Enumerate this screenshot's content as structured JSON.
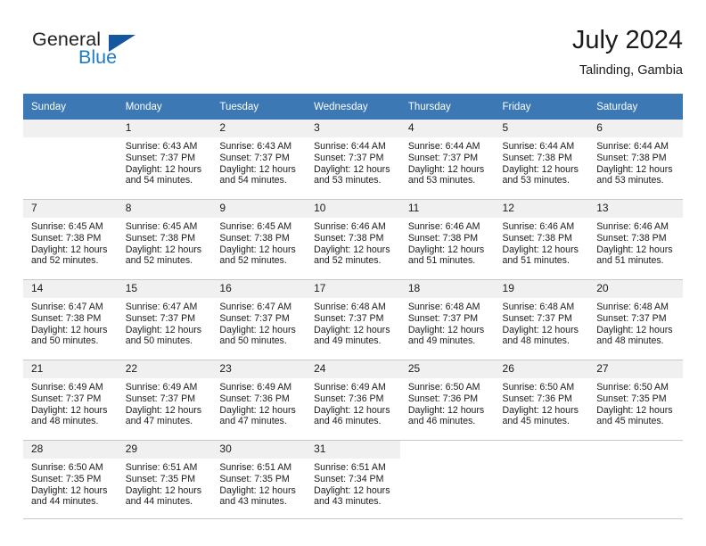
{
  "brand": {
    "word1": "General",
    "word2": "Blue",
    "triangle_color": "#15579e",
    "blue_color": "#1e7bc4"
  },
  "header": {
    "title": "July 2024",
    "subtitle": "Talinding, Gambia"
  },
  "theme": {
    "header_row_bg": "#3b78b4",
    "daynum_bg": "#f0f0f0",
    "grid_line": "#c8c8c8"
  },
  "weekdays": [
    "Sunday",
    "Monday",
    "Tuesday",
    "Wednesday",
    "Thursday",
    "Friday",
    "Saturday"
  ],
  "weeks": [
    [
      {
        "day": "",
        "blank": true,
        "sunrise": "",
        "sunset": "",
        "daylight1": "",
        "daylight2": ""
      },
      {
        "day": "1",
        "sunrise": "Sunrise: 6:43 AM",
        "sunset": "Sunset: 7:37 PM",
        "daylight1": "Daylight: 12 hours",
        "daylight2": "and 54 minutes."
      },
      {
        "day": "2",
        "sunrise": "Sunrise: 6:43 AM",
        "sunset": "Sunset: 7:37 PM",
        "daylight1": "Daylight: 12 hours",
        "daylight2": "and 54 minutes."
      },
      {
        "day": "3",
        "sunrise": "Sunrise: 6:44 AM",
        "sunset": "Sunset: 7:37 PM",
        "daylight1": "Daylight: 12 hours",
        "daylight2": "and 53 minutes."
      },
      {
        "day": "4",
        "sunrise": "Sunrise: 6:44 AM",
        "sunset": "Sunset: 7:37 PM",
        "daylight1": "Daylight: 12 hours",
        "daylight2": "and 53 minutes."
      },
      {
        "day": "5",
        "sunrise": "Sunrise: 6:44 AM",
        "sunset": "Sunset: 7:38 PM",
        "daylight1": "Daylight: 12 hours",
        "daylight2": "and 53 minutes."
      },
      {
        "day": "6",
        "sunrise": "Sunrise: 6:44 AM",
        "sunset": "Sunset: 7:38 PM",
        "daylight1": "Daylight: 12 hours",
        "daylight2": "and 53 minutes."
      }
    ],
    [
      {
        "day": "7",
        "sunrise": "Sunrise: 6:45 AM",
        "sunset": "Sunset: 7:38 PM",
        "daylight1": "Daylight: 12 hours",
        "daylight2": "and 52 minutes."
      },
      {
        "day": "8",
        "sunrise": "Sunrise: 6:45 AM",
        "sunset": "Sunset: 7:38 PM",
        "daylight1": "Daylight: 12 hours",
        "daylight2": "and 52 minutes."
      },
      {
        "day": "9",
        "sunrise": "Sunrise: 6:45 AM",
        "sunset": "Sunset: 7:38 PM",
        "daylight1": "Daylight: 12 hours",
        "daylight2": "and 52 minutes."
      },
      {
        "day": "10",
        "sunrise": "Sunrise: 6:46 AM",
        "sunset": "Sunset: 7:38 PM",
        "daylight1": "Daylight: 12 hours",
        "daylight2": "and 52 minutes."
      },
      {
        "day": "11",
        "sunrise": "Sunrise: 6:46 AM",
        "sunset": "Sunset: 7:38 PM",
        "daylight1": "Daylight: 12 hours",
        "daylight2": "and 51 minutes."
      },
      {
        "day": "12",
        "sunrise": "Sunrise: 6:46 AM",
        "sunset": "Sunset: 7:38 PM",
        "daylight1": "Daylight: 12 hours",
        "daylight2": "and 51 minutes."
      },
      {
        "day": "13",
        "sunrise": "Sunrise: 6:46 AM",
        "sunset": "Sunset: 7:38 PM",
        "daylight1": "Daylight: 12 hours",
        "daylight2": "and 51 minutes."
      }
    ],
    [
      {
        "day": "14",
        "sunrise": "Sunrise: 6:47 AM",
        "sunset": "Sunset: 7:38 PM",
        "daylight1": "Daylight: 12 hours",
        "daylight2": "and 50 minutes."
      },
      {
        "day": "15",
        "sunrise": "Sunrise: 6:47 AM",
        "sunset": "Sunset: 7:37 PM",
        "daylight1": "Daylight: 12 hours",
        "daylight2": "and 50 minutes."
      },
      {
        "day": "16",
        "sunrise": "Sunrise: 6:47 AM",
        "sunset": "Sunset: 7:37 PM",
        "daylight1": "Daylight: 12 hours",
        "daylight2": "and 50 minutes."
      },
      {
        "day": "17",
        "sunrise": "Sunrise: 6:48 AM",
        "sunset": "Sunset: 7:37 PM",
        "daylight1": "Daylight: 12 hours",
        "daylight2": "and 49 minutes."
      },
      {
        "day": "18",
        "sunrise": "Sunrise: 6:48 AM",
        "sunset": "Sunset: 7:37 PM",
        "daylight1": "Daylight: 12 hours",
        "daylight2": "and 49 minutes."
      },
      {
        "day": "19",
        "sunrise": "Sunrise: 6:48 AM",
        "sunset": "Sunset: 7:37 PM",
        "daylight1": "Daylight: 12 hours",
        "daylight2": "and 48 minutes."
      },
      {
        "day": "20",
        "sunrise": "Sunrise: 6:48 AM",
        "sunset": "Sunset: 7:37 PM",
        "daylight1": "Daylight: 12 hours",
        "daylight2": "and 48 minutes."
      }
    ],
    [
      {
        "day": "21",
        "sunrise": "Sunrise: 6:49 AM",
        "sunset": "Sunset: 7:37 PM",
        "daylight1": "Daylight: 12 hours",
        "daylight2": "and 48 minutes."
      },
      {
        "day": "22",
        "sunrise": "Sunrise: 6:49 AM",
        "sunset": "Sunset: 7:37 PM",
        "daylight1": "Daylight: 12 hours",
        "daylight2": "and 47 minutes."
      },
      {
        "day": "23",
        "sunrise": "Sunrise: 6:49 AM",
        "sunset": "Sunset: 7:36 PM",
        "daylight1": "Daylight: 12 hours",
        "daylight2": "and 47 minutes."
      },
      {
        "day": "24",
        "sunrise": "Sunrise: 6:49 AM",
        "sunset": "Sunset: 7:36 PM",
        "daylight1": "Daylight: 12 hours",
        "daylight2": "and 46 minutes."
      },
      {
        "day": "25",
        "sunrise": "Sunrise: 6:50 AM",
        "sunset": "Sunset: 7:36 PM",
        "daylight1": "Daylight: 12 hours",
        "daylight2": "and 46 minutes."
      },
      {
        "day": "26",
        "sunrise": "Sunrise: 6:50 AM",
        "sunset": "Sunset: 7:36 PM",
        "daylight1": "Daylight: 12 hours",
        "daylight2": "and 45 minutes."
      },
      {
        "day": "27",
        "sunrise": "Sunrise: 6:50 AM",
        "sunset": "Sunset: 7:35 PM",
        "daylight1": "Daylight: 12 hours",
        "daylight2": "and 45 minutes."
      }
    ],
    [
      {
        "day": "28",
        "sunrise": "Sunrise: 6:50 AM",
        "sunset": "Sunset: 7:35 PM",
        "daylight1": "Daylight: 12 hours",
        "daylight2": "and 44 minutes."
      },
      {
        "day": "29",
        "sunrise": "Sunrise: 6:51 AM",
        "sunset": "Sunset: 7:35 PM",
        "daylight1": "Daylight: 12 hours",
        "daylight2": "and 44 minutes."
      },
      {
        "day": "30",
        "sunrise": "Sunrise: 6:51 AM",
        "sunset": "Sunset: 7:35 PM",
        "daylight1": "Daylight: 12 hours",
        "daylight2": "and 43 minutes."
      },
      {
        "day": "31",
        "sunrise": "Sunrise: 6:51 AM",
        "sunset": "Sunset: 7:34 PM",
        "daylight1": "Daylight: 12 hours",
        "daylight2": "and 43 minutes."
      },
      {
        "day": "",
        "blank": true,
        "nofill": true,
        "sunrise": "",
        "sunset": "",
        "daylight1": "",
        "daylight2": ""
      },
      {
        "day": "",
        "blank": true,
        "nofill": true,
        "sunrise": "",
        "sunset": "",
        "daylight1": "",
        "daylight2": ""
      },
      {
        "day": "",
        "blank": true,
        "nofill": true,
        "sunrise": "",
        "sunset": "",
        "daylight1": "",
        "daylight2": ""
      }
    ]
  ]
}
